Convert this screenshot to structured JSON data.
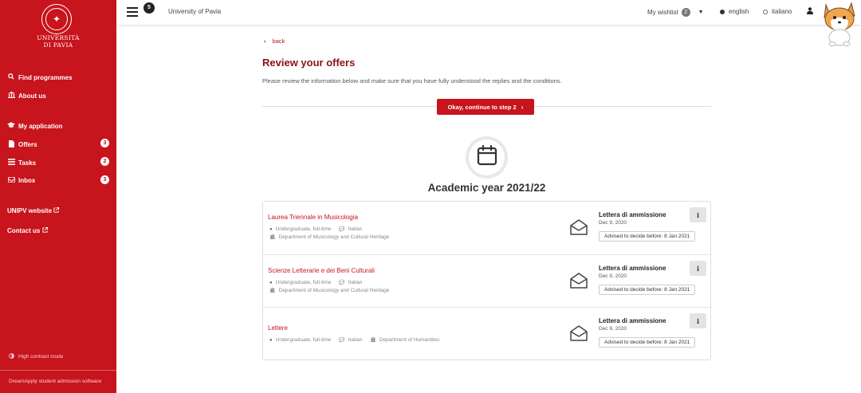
{
  "sidebar": {
    "logo_text_1": "UNIVERSITÀ",
    "logo_text_2": "DI PAVIA",
    "nav": [
      {
        "label": "Find programmes",
        "icon": "search-icon"
      },
      {
        "label": "About us",
        "icon": "university-icon"
      },
      {
        "label": "My application",
        "icon": "graduation-cap-icon"
      },
      {
        "label": "Offers",
        "icon": "document-icon",
        "badge": "3"
      },
      {
        "label": "Tasks",
        "icon": "list-icon",
        "badge": "2"
      },
      {
        "label": "Inbox",
        "icon": "inbox-icon",
        "badge": "3"
      }
    ],
    "links": [
      {
        "label": "UNIPV website"
      },
      {
        "label": "Contact us"
      }
    ],
    "high_contrast": "High contrast mode",
    "footer": "DreamApply student admission software"
  },
  "topbar": {
    "menu_badge": "5",
    "university": "University of Pavia",
    "wishlist_label": "My wishlist",
    "wishlist_count": "2",
    "languages": [
      {
        "label": "english",
        "selected": true
      },
      {
        "label": "italiano",
        "selected": false
      }
    ]
  },
  "main": {
    "back_label": "back",
    "title": "Review your offers",
    "description": "Please review the information below and make sure that you have fully understood the replies and the conditions.",
    "continue_label": "Okay, continue to step 2",
    "year_title": "Academic year 2021/22",
    "offers": [
      {
        "programme": "Laurea Triennale in Musicologia",
        "level": "Undergraduate, full-time",
        "language": "Italian",
        "department": "Department of Musicology and Cultural Heritage",
        "letter_title": "Lettera di ammissione",
        "letter_date": "Dec 9, 2020",
        "decide": "Advised to decide before: 8 Jan 2021",
        "info": "i"
      },
      {
        "programme": "Scienze Letterarie e dei Beni Culturali",
        "level": "Undergraduate, full-time",
        "language": "Italian",
        "department": "Department of Musicology and Cultural Heritage",
        "letter_title": "Lettera di ammissione",
        "letter_date": "Dec 9, 2020",
        "decide": "Advised to decide before: 8 Jan 2021",
        "info": "i"
      },
      {
        "programme": "Lettere",
        "level": "Undergraduate, full-time",
        "language": "Italian",
        "department": "Department of Humanities",
        "letter_title": "Lettera di ammissione",
        "letter_date": "Dec 9, 2020",
        "decide": "Advised to decide before: 8 Jan 2021",
        "info": "i"
      }
    ]
  },
  "colors": {
    "brand_red": "#c8141c",
    "title_red": "#8b1116"
  }
}
